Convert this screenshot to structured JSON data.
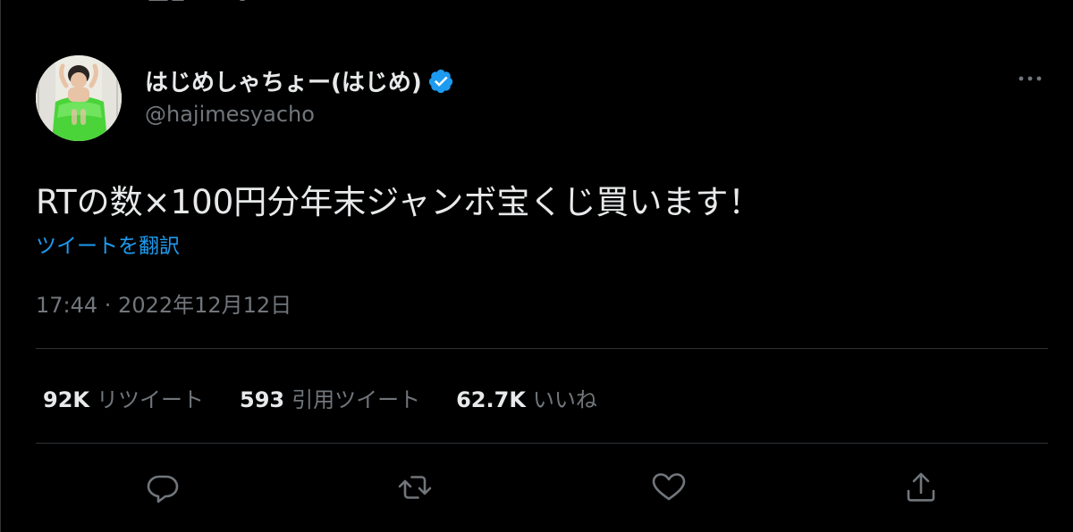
{
  "tweet": {
    "author": {
      "display_name": "はじめしゃちょー(はじめ)",
      "handle": "@hajimesyacho",
      "verified": true
    },
    "text": "RTの数×100円分年末ジャンボ宝くじ買います！",
    "translate_label": "ツイートを翻訳",
    "timestamp": "17:44 · 2022年12月12日"
  },
  "stats": {
    "retweets": {
      "count": "92K",
      "label": "リツイート"
    },
    "quotes": {
      "count": "593",
      "label": "引用ツイート"
    },
    "likes": {
      "count": "62.7K",
      "label": "いいね"
    }
  },
  "actions": [
    {
      "icon": "reply-icon"
    },
    {
      "icon": "retweet-icon"
    },
    {
      "icon": "like-icon"
    },
    {
      "icon": "share-icon"
    }
  ],
  "colors": {
    "background": "#000000",
    "text_primary": "#e7e9ea",
    "text_secondary": "#71767b",
    "link": "#1d9bf0",
    "divider": "#2f3336",
    "verified_badge": "#1d9bf0"
  }
}
